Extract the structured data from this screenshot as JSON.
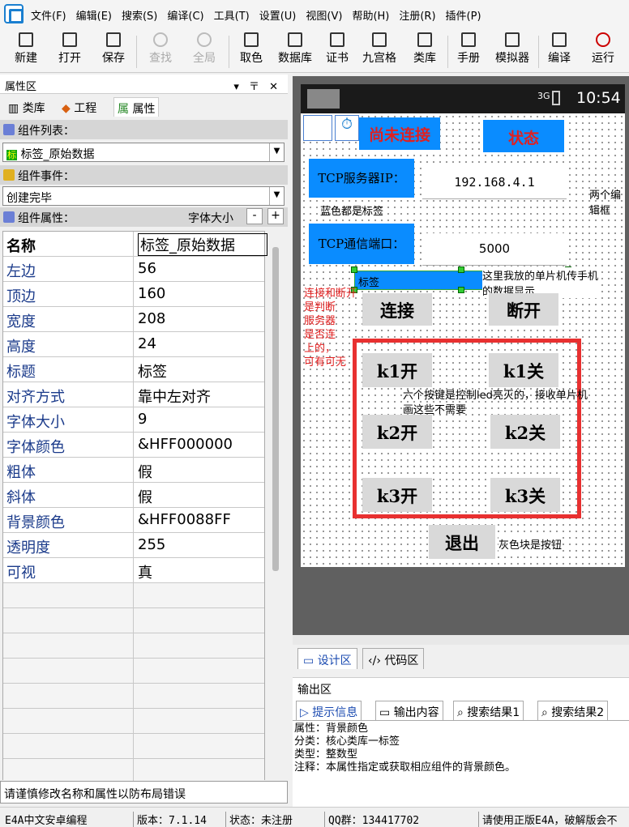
{
  "menu": [
    "文件(F)",
    "编辑(E)",
    "搜索(S)",
    "编译(C)",
    "工具(T)",
    "设置(U)",
    "视图(V)",
    "帮助(H)",
    "注册(R)",
    "插件(P)"
  ],
  "toolbar": {
    "new": "新建",
    "open": "打开",
    "save": "保存",
    "find": "查找",
    "global": "全局",
    "pick": "取色",
    "db": "数据库",
    "cert": "证书",
    "grid": "九宫格",
    "lib": "类库",
    "manual": "手册",
    "emu": "模拟器",
    "compile": "编译",
    "run": "运行"
  },
  "left": {
    "title": "属性区",
    "tabs": [
      "类库",
      "工程",
      "属性"
    ],
    "component_list_label": "组件列表：",
    "component_selected": "标签_原始数据",
    "events_label": "组件事件：",
    "event_selected": "创建完毕",
    "props_label": "组件属性：",
    "font_size_label": "字体大小",
    "props": [
      {
        "k": "名称",
        "v": "标签_原始数据"
      },
      {
        "k": "左边",
        "v": "56"
      },
      {
        "k": "顶边",
        "v": "160"
      },
      {
        "k": "宽度",
        "v": "208"
      },
      {
        "k": "高度",
        "v": "24"
      },
      {
        "k": "标题",
        "v": "标签"
      },
      {
        "k": "对齐方式",
        "v": "靠中左对齐"
      },
      {
        "k": "字体大小",
        "v": "9"
      },
      {
        "k": "字体颜色",
        "v": "&HFF000000"
      },
      {
        "k": "粗体",
        "v": "假"
      },
      {
        "k": "斜体",
        "v": "假"
      },
      {
        "k": "背景颜色",
        "v": "&HFF0088FF"
      },
      {
        "k": "透明度",
        "v": "255"
      },
      {
        "k": "可视",
        "v": "真"
      }
    ],
    "hint": "请谨慎修改名称和属性以防布局错误"
  },
  "phone": {
    "time": "10:54",
    "signal": "3G"
  },
  "canvas": {
    "not_connected": "尚未连接",
    "state": "状态",
    "tcp_ip_label": "TCP服务器IP：",
    "ip_value": "192.168.4.1",
    "port_label": "TCP通信端口：",
    "port_value": "5000",
    "label_text": "标签",
    "connect": "连接",
    "disconnect": "断开",
    "k1on": "k1开",
    "k1off": "k1关",
    "k2on": "k2开",
    "k2off": "k2关",
    "k3on": "k3开",
    "k3off": "k3关",
    "exit": "退出",
    "note_blue": "蓝色都是标签",
    "note_edit": "两个编\n辑框",
    "note_data": "这里我放的单片机传手机\n的数据显示",
    "note_connect": "连接和断开\n是判断\n服务器\n是否连\n上的，\n可有可无",
    "note_six": "六个按键是控制led亮灭的，接收单片机\n画这些不需要",
    "note_gray": "灰色块是按钮"
  },
  "design_tabs": [
    "设计区",
    "代码区"
  ],
  "output": {
    "title": "输出区",
    "tabs": [
      "提示信息",
      "输出内容",
      "搜索结果1",
      "搜索结果2"
    ],
    "lines": [
      "属性：背景颜色",
      "分类：核心类库一标签",
      "类型：整数型",
      "注释：本属性指定或获取相应组件的背景颜色。"
    ]
  },
  "status": {
    "app": "E4A中文安卓编程",
    "version": "版本：7.1.14",
    "state": "状态：未注册",
    "qq": "QQ群：134417702",
    "notice": "请使用正版E4A，破解版会不"
  },
  "colors": {
    "label_blue": "#0a8cff",
    "red_text": "#e02020",
    "button_gray": "#d9d9d9"
  }
}
